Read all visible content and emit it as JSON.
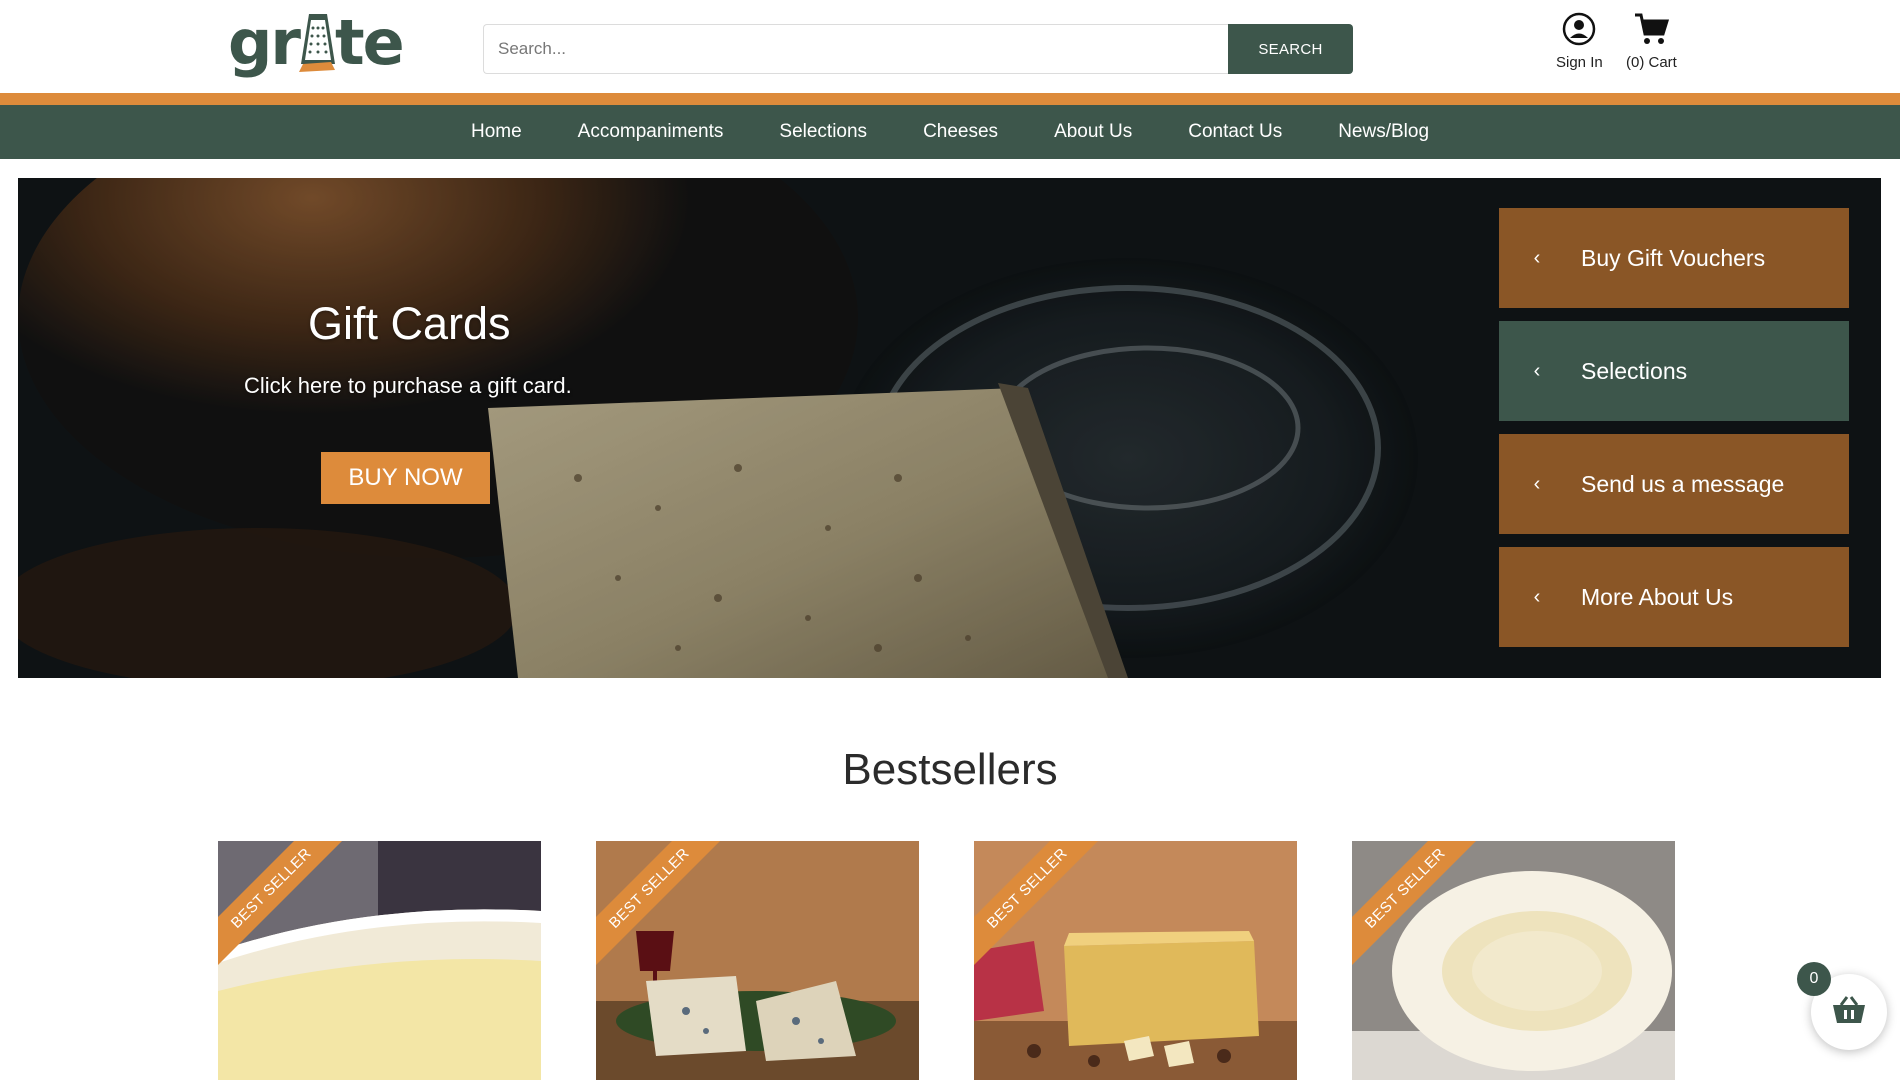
{
  "brand": {
    "logo_left": "gr",
    "logo_right": "te",
    "colors": {
      "green": "#3d564b",
      "orange": "#dd8b3b",
      "brown": "#8a5626"
    }
  },
  "search": {
    "placeholder": "Search...",
    "button_label": "SEARCH"
  },
  "account": {
    "signin_label": "Sign In",
    "signin_icon": "user-circle-icon",
    "cart_label": "(0) Cart",
    "cart_icon": "shopping-cart-icon"
  },
  "nav": {
    "items": [
      {
        "label": "Home"
      },
      {
        "label": "Accompaniments"
      },
      {
        "label": "Selections"
      },
      {
        "label": "Cheeses"
      },
      {
        "label": "About Us"
      },
      {
        "label": "Contact Us"
      },
      {
        "label": "News/Blog"
      }
    ]
  },
  "hero": {
    "title": "Gift Cards",
    "subtitle": "Click here to purchase a gift card.",
    "button_label": "BUY NOW",
    "side_links": [
      {
        "label": "Buy Gift Vouchers",
        "color": "brown"
      },
      {
        "label": "Selections",
        "color": "green"
      },
      {
        "label": "Send us a message",
        "color": "brown"
      },
      {
        "label": "More About Us",
        "color": "brown"
      }
    ]
  },
  "bestsellers": {
    "title": "Bestsellers",
    "products": [
      {
        "badge": "BEST SELLER",
        "image": "white-rind-cheese-image"
      },
      {
        "badge": "BEST SELLER",
        "image": "blue-cheese-wine-image"
      },
      {
        "badge": "BEST SELLER",
        "image": "cheddar-block-image"
      },
      {
        "badge": "BEST SELLER",
        "image": "goat-cheese-log-image"
      }
    ]
  },
  "floating_cart": {
    "count": "0",
    "icon": "basket-icon"
  }
}
